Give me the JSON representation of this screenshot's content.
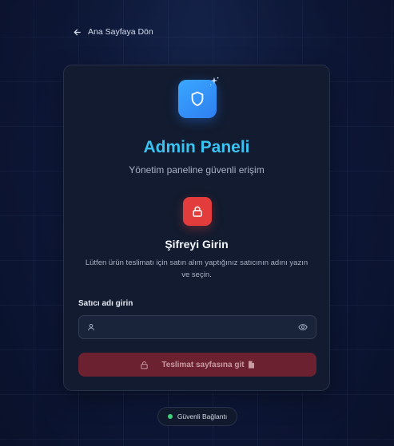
{
  "back_link": {
    "label": "Ana Sayfaya Dön"
  },
  "header": {
    "title": "Admin Paneli",
    "subtitle": "Yönetim paneline güvenli erişim"
  },
  "section": {
    "title": "Şifreyi Girin",
    "description": "Lütfen ürün teslimatı için satın alım yaptığınız satıcının adını yazın ve seçin."
  },
  "form": {
    "field_label": "Satıcı adı girin",
    "input_value": "",
    "input_placeholder": "",
    "submit_label": "Teslimat sayfasına git"
  },
  "status": {
    "label": "Güvenli Bağlantı"
  },
  "colors": {
    "title": "#3ac2f2",
    "logo_gradient_start": "#3aa7ff",
    "logo_gradient_end": "#2e7ff0",
    "lock_badge": "#e23c3c",
    "submit_disabled_bg": "#6b2130",
    "status_dot": "#3fd27a"
  },
  "icons": {
    "back": "arrow-left-icon",
    "logo": "shield-icon",
    "sparkle": "sparkle-icon",
    "lock": "lock-icon",
    "user": "user-icon",
    "eye": "eye-icon",
    "submit_lock": "lock-icon",
    "submit_doc": "document-icon"
  }
}
